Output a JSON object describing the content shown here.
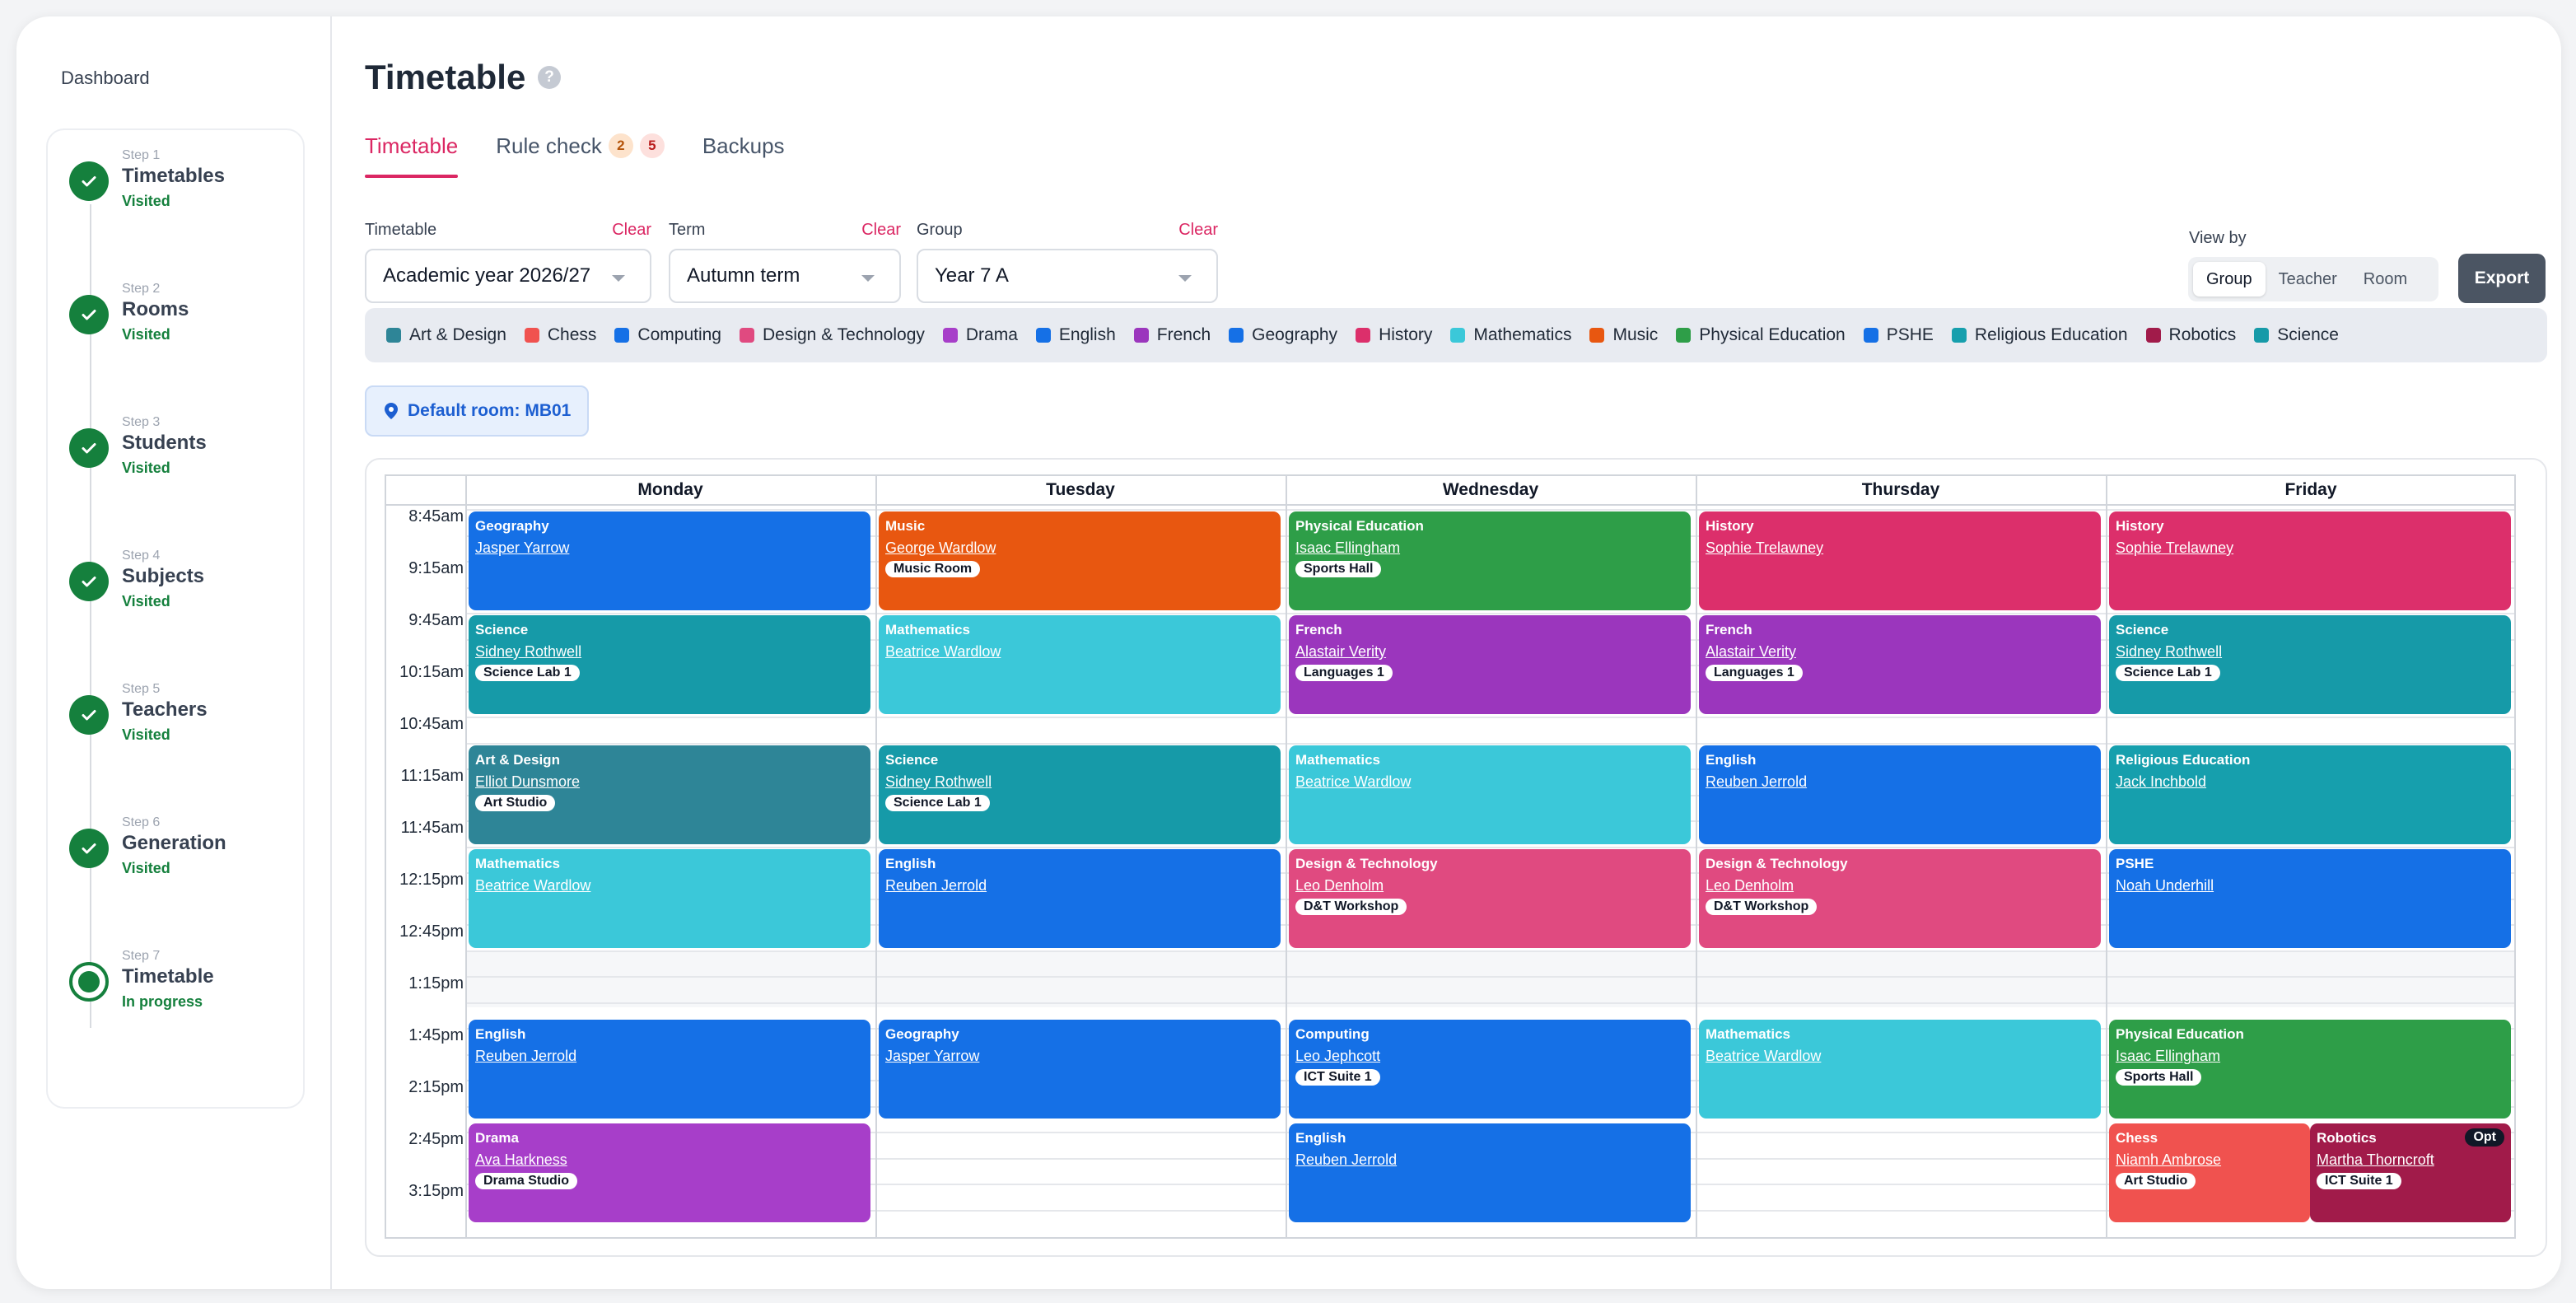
{
  "sidebar": {
    "dashboard": "Dashboard",
    "steps": [
      {
        "num": "Step 1",
        "title": "Timetables",
        "status": "Visited"
      },
      {
        "num": "Step 2",
        "title": "Rooms",
        "status": "Visited"
      },
      {
        "num": "Step 3",
        "title": "Students",
        "status": "Visited"
      },
      {
        "num": "Step 4",
        "title": "Subjects",
        "status": "Visited"
      },
      {
        "num": "Step 5",
        "title": "Teachers",
        "status": "Visited"
      },
      {
        "num": "Step 6",
        "title": "Generation",
        "status": "Visited"
      },
      {
        "num": "Step 7",
        "title": "Timetable",
        "status": "In progress"
      }
    ]
  },
  "header": {
    "title": "Timetable",
    "help_icon": "?"
  },
  "tabs": [
    {
      "label": "Timetable",
      "active": true
    },
    {
      "label": "Rule check",
      "badges": [
        "2",
        "5"
      ]
    },
    {
      "label": "Backups"
    }
  ],
  "filters": [
    {
      "label": "Timetable",
      "clear": "Clear",
      "value": "Academic year 2026/27"
    },
    {
      "label": "Term",
      "clear": "Clear",
      "value": "Autumn term"
    },
    {
      "label": "Group",
      "clear": "Clear",
      "value": "Year 7 A"
    }
  ],
  "view_by": {
    "label": "View by",
    "options": [
      "Group",
      "Teacher",
      "Room"
    ],
    "selected": "Group"
  },
  "export_label": "Export",
  "legend": [
    {
      "name": "Art & Design",
      "color": "#2e8597"
    },
    {
      "name": "Chess",
      "color": "#f0524f"
    },
    {
      "name": "Computing",
      "color": "#1570e6"
    },
    {
      "name": "Design & Technology",
      "color": "#e04a80"
    },
    {
      "name": "Drama",
      "color": "#a73ec9"
    },
    {
      "name": "English",
      "color": "#1570e6"
    },
    {
      "name": "French",
      "color": "#9b36bd"
    },
    {
      "name": "Geography",
      "color": "#1570e6"
    },
    {
      "name": "History",
      "color": "#dc2f6b"
    },
    {
      "name": "Mathematics",
      "color": "#3bc8d9"
    },
    {
      "name": "Music",
      "color": "#e85710"
    },
    {
      "name": "Physical Education",
      "color": "#2e9e48"
    },
    {
      "name": "PSHE",
      "color": "#1570e6"
    },
    {
      "name": "Religious Education",
      "color": "#169fad"
    },
    {
      "name": "Robotics",
      "color": "#a11b4a"
    },
    {
      "name": "Science",
      "color": "#169aa8"
    }
  ],
  "default_room": "Default room: MB01",
  "days": [
    "Monday",
    "Tuesday",
    "Wednesday",
    "Thursday",
    "Friday"
  ],
  "times": [
    "8:45am",
    "9:15am",
    "9:45am",
    "10:15am",
    "10:45am",
    "11:15am",
    "11:45am",
    "12:15pm",
    "12:45pm",
    "1:15pm",
    "1:45pm",
    "2:15pm",
    "2:45pm",
    "3:15pm"
  ],
  "lessons": [
    {
      "day": 0,
      "start": 0,
      "span": 2,
      "subject": "Geography",
      "teacher": "Jasper Yarrow",
      "color": "#1570e6"
    },
    {
      "day": 0,
      "start": 2,
      "span": 2,
      "subject": "Science",
      "teacher": "Sidney Rothwell",
      "room": "Science Lab 1",
      "color": "#169aa8"
    },
    {
      "day": 0,
      "start": 4.5,
      "span": 2,
      "subject": "Art & Design",
      "teacher": "Elliot Dunsmore",
      "room": "Art Studio",
      "color": "#2e8597"
    },
    {
      "day": 0,
      "start": 6.5,
      "span": 2,
      "subject": "Mathematics",
      "teacher": "Beatrice Wardlow",
      "color": "#3bc8d9"
    },
    {
      "day": 0,
      "start": 9.8,
      "span": 2,
      "subject": "English",
      "teacher": "Reuben Jerrold",
      "color": "#1570e6"
    },
    {
      "day": 0,
      "start": 11.8,
      "span": 2,
      "subject": "Drama",
      "teacher": "Ava Harkness",
      "room": "Drama Studio",
      "color": "#a73ec9"
    },
    {
      "day": 1,
      "start": 0,
      "span": 2,
      "subject": "Music",
      "teacher": "George Wardlow",
      "room": "Music Room",
      "color": "#e85710"
    },
    {
      "day": 1,
      "start": 2,
      "span": 2,
      "subject": "Mathematics",
      "teacher": "Beatrice Wardlow",
      "color": "#3bc8d9"
    },
    {
      "day": 1,
      "start": 4.5,
      "span": 2,
      "subject": "Science",
      "teacher": "Sidney Rothwell",
      "room": "Science Lab 1",
      "color": "#169aa8"
    },
    {
      "day": 1,
      "start": 6.5,
      "span": 2,
      "subject": "English",
      "teacher": "Reuben Jerrold",
      "color": "#1570e6"
    },
    {
      "day": 1,
      "start": 9.8,
      "span": 2,
      "subject": "Geography",
      "teacher": "Jasper Yarrow",
      "color": "#1570e6"
    },
    {
      "day": 2,
      "start": 0,
      "span": 2,
      "subject": "Physical Education",
      "teacher": "Isaac Ellingham",
      "room": "Sports Hall",
      "color": "#2e9e48"
    },
    {
      "day": 2,
      "start": 2,
      "span": 2,
      "subject": "French",
      "teacher": "Alastair Verity",
      "room": "Languages 1",
      "color": "#9b36bd"
    },
    {
      "day": 2,
      "start": 4.5,
      "span": 2,
      "subject": "Mathematics",
      "teacher": "Beatrice Wardlow",
      "color": "#3bc8d9"
    },
    {
      "day": 2,
      "start": 6.5,
      "span": 2,
      "subject": "Design & Technology",
      "teacher": "Leo Denholm",
      "room": "D&T Workshop",
      "color": "#e04a80"
    },
    {
      "day": 2,
      "start": 9.8,
      "span": 2,
      "subject": "Computing",
      "teacher": "Leo Jephcott",
      "room": "ICT Suite 1",
      "color": "#1570e6"
    },
    {
      "day": 2,
      "start": 11.8,
      "span": 2,
      "subject": "English",
      "teacher": "Reuben Jerrold",
      "color": "#1570e6"
    },
    {
      "day": 3,
      "start": 0,
      "span": 2,
      "subject": "History",
      "teacher": "Sophie Trelawney",
      "color": "#dc2f6b"
    },
    {
      "day": 3,
      "start": 2,
      "span": 2,
      "subject": "French",
      "teacher": "Alastair Verity",
      "room": "Languages 1",
      "color": "#9b36bd"
    },
    {
      "day": 3,
      "start": 4.5,
      "span": 2,
      "subject": "English",
      "teacher": "Reuben Jerrold",
      "color": "#1570e6"
    },
    {
      "day": 3,
      "start": 6.5,
      "span": 2,
      "subject": "Design & Technology",
      "teacher": "Leo Denholm",
      "room": "D&T Workshop",
      "color": "#e04a80"
    },
    {
      "day": 3,
      "start": 9.8,
      "span": 2,
      "subject": "Mathematics",
      "teacher": "Beatrice Wardlow",
      "color": "#3bc8d9"
    },
    {
      "day": 4,
      "start": 0,
      "span": 2,
      "subject": "History",
      "teacher": "Sophie Trelawney",
      "color": "#dc2f6b"
    },
    {
      "day": 4,
      "start": 2,
      "span": 2,
      "subject": "Science",
      "teacher": "Sidney Rothwell",
      "room": "Science Lab 1",
      "color": "#169aa8"
    },
    {
      "day": 4,
      "start": 4.5,
      "span": 2,
      "subject": "Religious Education",
      "teacher": "Jack Inchbold",
      "color": "#169fad"
    },
    {
      "day": 4,
      "start": 6.5,
      "span": 2,
      "subject": "PSHE",
      "teacher": "Noah Underhill",
      "color": "#1570e6"
    },
    {
      "day": 4,
      "start": 9.8,
      "span": 2,
      "subject": "Physical Education",
      "teacher": "Isaac Ellingham",
      "room": "Sports Hall",
      "color": "#2e9e48"
    },
    {
      "day": 4,
      "start": 11.8,
      "span": 2,
      "subject": "Chess",
      "teacher": "Niamh Ambrose",
      "room": "Art Studio",
      "color": "#f0524f",
      "half": "left"
    },
    {
      "day": 4,
      "start": 11.8,
      "span": 2,
      "subject": "Robotics",
      "teacher": "Martha Thorncroft",
      "room": "ICT Suite 1",
      "color": "#a11b4a",
      "half": "right",
      "badge": "Opt"
    }
  ]
}
